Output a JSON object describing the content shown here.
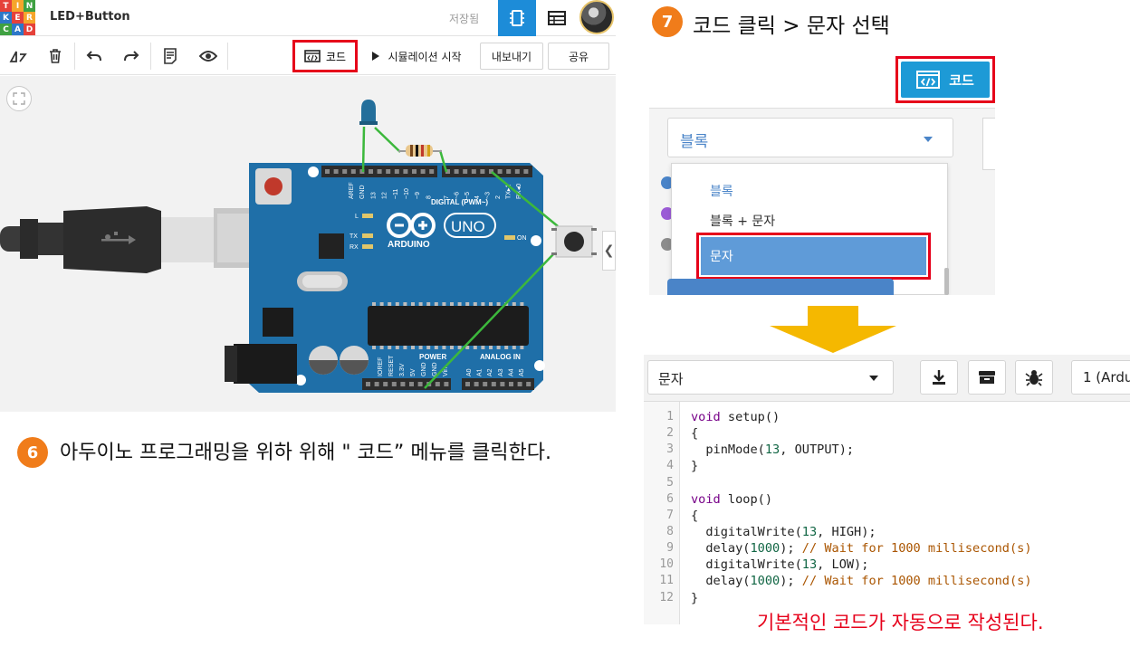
{
  "app": {
    "logo_letters": [
      "T",
      "I",
      "N",
      "K",
      "E",
      "R",
      "C",
      "A",
      "D"
    ],
    "logo_colors": [
      "#e5413a",
      "#f6a52b",
      "#3fa142",
      "#2d78c8",
      "#e5413a",
      "#f6a52b",
      "#3fa142",
      "#2d78c8",
      "#e5413a"
    ],
    "project_title": "LED+Button",
    "saved_status": "저장됨",
    "accent": "#1d8cd8"
  },
  "toolbar": {
    "code_label": "코드",
    "simulate_label": "시뮬레이션 시작",
    "export_label": "내보내기",
    "share_label": "공유"
  },
  "circuit": {
    "board_brand": "ARDUINO",
    "board_model": "UNO",
    "digital_label": "DIGITAL (PWM~)",
    "power_label": "POWER",
    "analog_label": "ANALOG IN",
    "on_label": "ON",
    "l_label": "L",
    "tx_label": "TX",
    "rx_label": "RX",
    "digital_pins": [
      "AREF",
      "GND",
      "13",
      "12",
      "~11",
      "~10",
      "~9",
      "8",
      "7",
      "~6",
      "~5",
      "4",
      "~3",
      "2",
      "TX▸1",
      "RX◂0"
    ],
    "power_pins": [
      "IOREF",
      "RESET",
      "3.3V",
      "5V",
      "GND",
      "GND",
      "Vin"
    ],
    "analog_pins": [
      "A0",
      "A1",
      "A2",
      "A3",
      "A4",
      "A5"
    ]
  },
  "step6": {
    "number": "6",
    "text": "아두이노 프로그래밍을 위하 위해 \" 코드” 메뉴를 클릭한다."
  },
  "step7": {
    "number": "7",
    "text": "코드 클릭 > 문자 선택"
  },
  "crop1": {
    "code_button_label": "코드",
    "mode_selected": "블록",
    "dropdown_options": [
      "블록",
      "블록 + 문자",
      "문자"
    ],
    "dot_colors": [
      "#4a84c8",
      "#9b5bd6",
      "#8c8c8c"
    ]
  },
  "editor": {
    "mode_selected": "문자",
    "line_select": "1 (Ardu",
    "line_numbers": [
      "1",
      "2",
      "3",
      "4",
      "5",
      "6",
      "7",
      "8",
      "9",
      "10",
      "11",
      "12"
    ],
    "auto_note": "기본적인 코드가 자동으로 작성된다."
  },
  "code": {
    "l1_kw": "void",
    "l1_rest": " setup()",
    "l2": "{",
    "l3_a": "  pinMode(",
    "l3_n": "13",
    "l3_b": ", OUTPUT);",
    "l4": "}",
    "l6_kw": "void",
    "l6_rest": " loop()",
    "l7": "{",
    "l8_a": "  digitalWrite(",
    "l8_n": "13",
    "l8_b": ", HIGH);",
    "l9_a": "  delay(",
    "l9_n": "1000",
    "l9_b": "); ",
    "l9_c": "// Wait for 1000 millisecond(s)",
    "l10_a": "  digitalWrite(",
    "l10_n": "13",
    "l10_b": ", LOW);",
    "l11_a": "  delay(",
    "l11_n": "1000",
    "l11_b": "); ",
    "l11_c": "// Wait for 1000 millisecond(s)",
    "l12": "}"
  }
}
